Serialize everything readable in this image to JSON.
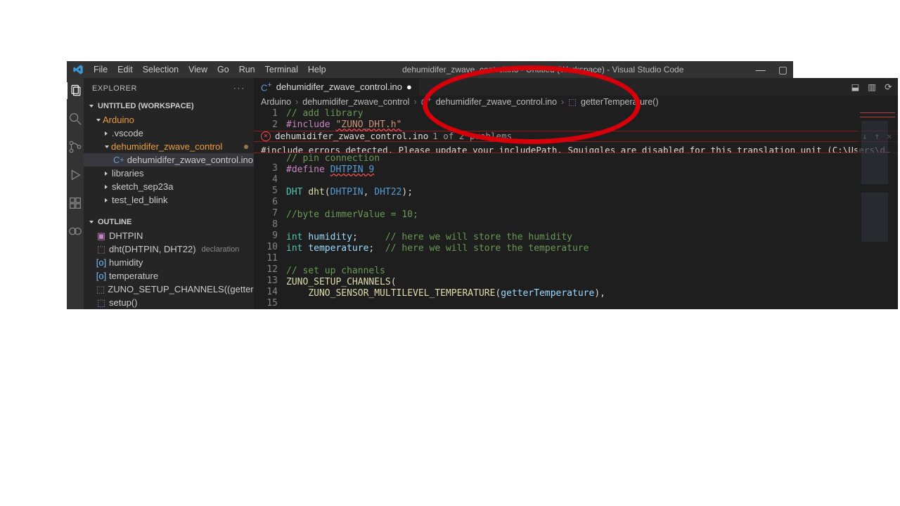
{
  "titlebar": {
    "menus": [
      "File",
      "Edit",
      "Selection",
      "View",
      "Go",
      "Run",
      "Terminal",
      "Help"
    ],
    "title": "dehumidifer_zwave_control.ino - Untitled (Workspace) - Visual Studio Code"
  },
  "sidebar": {
    "header": "EXPLORER",
    "section": "UNTITLED (WORKSPACE)",
    "tree": [
      {
        "indent": 1,
        "kind": "folder-open",
        "label": "Arduino",
        "orange": true
      },
      {
        "indent": 2,
        "kind": "folder",
        "label": ".vscode"
      },
      {
        "indent": 2,
        "kind": "folder-open",
        "label": "dehumidifer_zwave_control",
        "orange": true,
        "modified": true
      },
      {
        "indent": 3,
        "kind": "cpp",
        "label": "dehumidifer_zwave_control.ino",
        "selected": true,
        "modified": true
      },
      {
        "indent": 2,
        "kind": "folder",
        "label": "libraries"
      },
      {
        "indent": 2,
        "kind": "folder",
        "label": "sketch_sep23a"
      },
      {
        "indent": 2,
        "kind": "folder",
        "label": "test_led_blink"
      }
    ],
    "outline_header": "OUTLINE",
    "outline": [
      {
        "icon": "def",
        "label": "DHTPIN"
      },
      {
        "icon": "box",
        "label": "dht(DHTPIN, DHT22)",
        "extra": "declaration"
      },
      {
        "icon": "var",
        "label": "humidity"
      },
      {
        "icon": "var",
        "label": "temperature"
      },
      {
        "icon": "box",
        "label": "ZUNO_SETUP_CHANNELS((getterT…"
      },
      {
        "icon": "box",
        "label": "setup()"
      }
    ]
  },
  "tab": {
    "label": "dehumidifer_zwave_control.ino"
  },
  "breadcrumbs": [
    "Arduino",
    "dehumidifer_zwave_control",
    "dehumidifer_zwave_control.ino",
    "getterTemperature()"
  ],
  "error": {
    "file": "dehumidifer_zwave_control.ino",
    "count": "1 of 2 problems",
    "msg": "#include errors detected. Please update your includePath. Squiggles are disabled for this translation unit (C:\\Users\\d…"
  },
  "lines": [
    {
      "n": 1,
      "html": "<span class='tok-cm'>// add library</span>"
    },
    {
      "n": 2,
      "html": "<span class='tok-kw'>#include</span> <span class='tok-str wavy'>\"ZUNO_DHT.h\"</span>"
    },
    {
      "err": true
    },
    {
      "n": 3,
      "html": "<span class='tok-cm'>// pin connection</span>"
    },
    {
      "n": 4,
      "html": "<span class='tok-kw'>#define</span> <span class='tok-mac wavy'>DHTPIN 9</span>"
    },
    {
      "n": 5,
      "html": ""
    },
    {
      "n": 6,
      "html": "<span class='tok-type'>DHT</span> <span class='tok-fn'>dht</span>(<span class='tok-mac'>DHTPIN</span>, <span class='tok-mac'>DHT22</span>);"
    },
    {
      "n": 7,
      "html": ""
    },
    {
      "n": 8,
      "html": "<span class='tok-cm'>//byte dimmerValue = 10;</span>"
    },
    {
      "n": 9,
      "html": ""
    },
    {
      "n": 10,
      "html": "<span class='tok-type'>int</span> <span class='tok-id'>humidity</span>;     <span class='tok-cm'>// here we will store the humidity</span>"
    },
    {
      "n": 11,
      "html": "<span class='tok-type'>int</span> <span class='tok-id'>temperature</span>;  <span class='tok-cm'>// here we will store the temperature</span>"
    },
    {
      "n": 12,
      "html": ""
    },
    {
      "n": 13,
      "html": "<span class='tok-cm'>// set up channels</span>"
    },
    {
      "n": 14,
      "html": "<span class='tok-fn'>ZUNO_SETUP_CHANNELS</span>("
    },
    {
      "n": 15,
      "html": "    <span class='tok-fn'>ZUNO_SENSOR_MULTILEVEL_TEMPERATURE</span>(<span class='tok-id'>getterTemperature</span>),"
    }
  ]
}
